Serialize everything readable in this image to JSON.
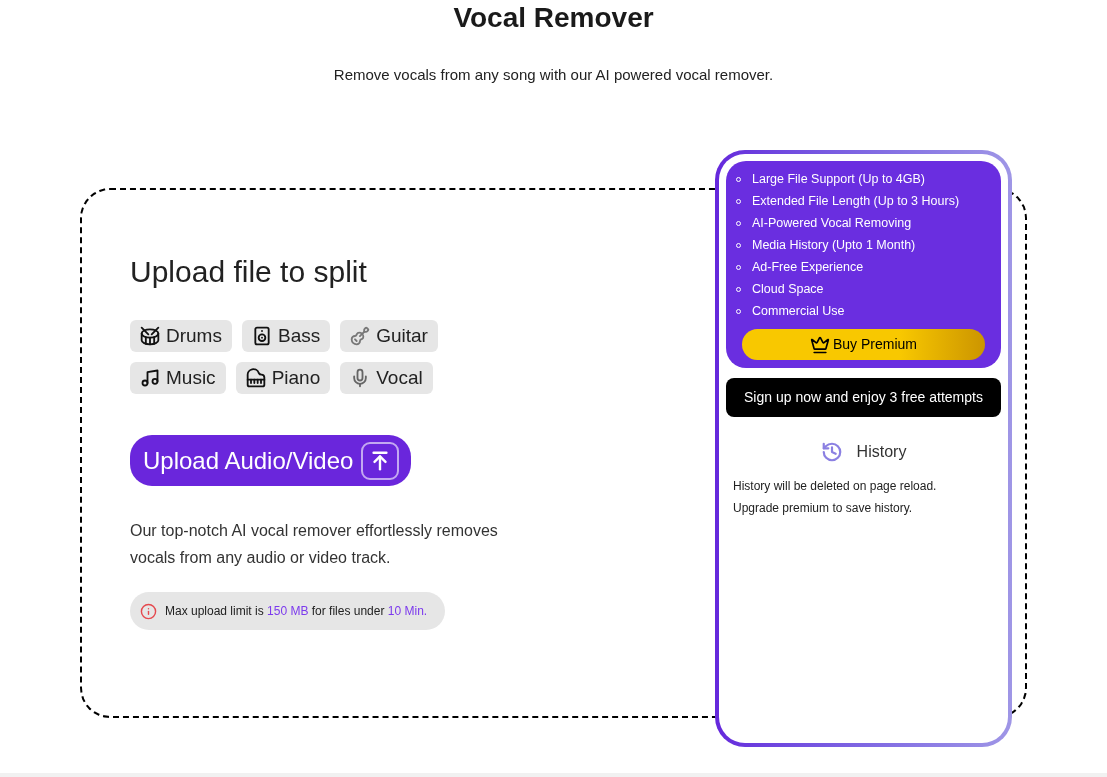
{
  "page": {
    "title": "Vocal Remover",
    "subtitle": "Remove vocals from any song with our AI powered vocal remover."
  },
  "upload_panel": {
    "heading": "Upload file to split",
    "stems": [
      {
        "kind": "drums",
        "label": "Drums"
      },
      {
        "kind": "bass",
        "label": "Bass"
      },
      {
        "kind": "guitar",
        "label": "Guitar"
      },
      {
        "kind": "music",
        "label": "Music"
      },
      {
        "kind": "piano",
        "label": "Piano"
      },
      {
        "kind": "vocal",
        "label": "Vocal"
      }
    ],
    "upload_button": "Upload Audio/Video",
    "description": "Our top-notch AI vocal remover effortlessly removes vocals from any audio or video track.",
    "notice": [
      {
        "kind": "plain",
        "text": "Max upload limit is "
      },
      {
        "kind": "accent",
        "text": "150 MB"
      },
      {
        "kind": "plain",
        "text": " for files under "
      },
      {
        "kind": "accent",
        "text": "10 Min."
      }
    ]
  },
  "premium_card": {
    "features": [
      "Large File Support (Up to 4GB)",
      "Extended File Length (Up to 3 Hours)",
      "AI-Powered Vocal Removing",
      "Media History (Upto 1 Month)",
      "Ad-Free Experience",
      "Cloud Space",
      "Commercial Use"
    ],
    "buy_button": "Buy Premium",
    "signup_button": "Sign up now and enjoy 3 free attempts",
    "history": {
      "title": "History",
      "notes": [
        "History will be deleted on page reload.",
        "Upgrade premium to save history."
      ]
    }
  }
}
